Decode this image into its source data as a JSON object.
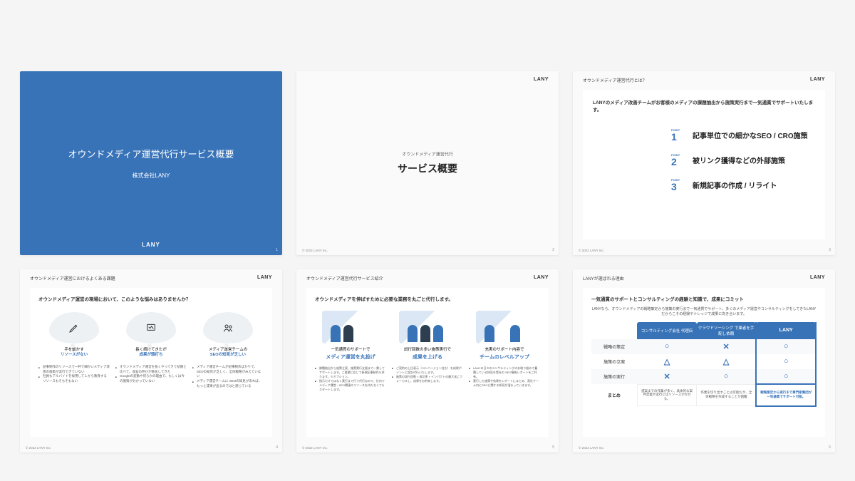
{
  "brand": "LANY",
  "copyright": "© 2022 LANY Inc.",
  "slide1": {
    "title": "オウンドメディア運営代行サービス概要",
    "company": "株式会社LANY",
    "page": "1"
  },
  "slide2": {
    "pre": "オウンドメディア運営代行",
    "title": "サービス概要",
    "page": "2"
  },
  "slide3": {
    "crumb": "オウンドメディア運営代行とは？",
    "intro": "LANYのメディア改善チームがお客様のメディアの課題抽出から施策実行まで一気通貫でサポートいたします。",
    "point_label": "POINT",
    "points": [
      {
        "n": "1",
        "t": "記事単位での細かなSEO / CRO施策"
      },
      {
        "n": "2",
        "t": "被リンク獲得などの外部施策"
      },
      {
        "n": "3",
        "t": "新規記事の作成 / リライト"
      }
    ],
    "page": "3"
  },
  "slide4": {
    "crumb": "オウンドメディア運営におけるよくある課題",
    "q": "オウンドメディア運営の現場において、このような悩みはありませんか？",
    "cols": [
      {
        "pre": "手を動かす",
        "hl": "リソースがない",
        "bullets": [
          "記事制作のリソースで一杯で細かいメディア改善の施策が実行できていない",
          "社員もアルバイトを採用して１から教育するリソースもそもそもない"
        ]
      },
      {
        "pre": "長く続けてきたが",
        "hl": "成果が頭打ち",
        "bullets": [
          "オウンドメディア運営を長くやってきて初期と比べて、収益の伸びが鈍化してきた",
          "Googleの変動や何らかの理由で、もしくは今の施策が分かっていない"
        ]
      },
      {
        "pre": "メディア運営チームの",
        "hl": "SEOの知見が乏しい",
        "bullets": [
          "メディア運営チームが記事制作ばかりで、SEOの知見が乏しく、全体戦略がみえていない",
          "メディア運営チームに SEOの知見があれば、もっと成果が出るのではと感じている"
        ]
      }
    ],
    "page": "4"
  },
  "slide5": {
    "crumb": "オウンドメディア運営代行サービス紹介",
    "q": "オウンドメディアを伸ばすために必要な業務を丸ごと代行します。",
    "cols": [
      {
        "pre": "一気通貫のサポートで",
        "hl": "メディア運営を丸投げ",
        "bullets": [
          "課題抽出から施策立案、施策実行支援まで一貫してサポートします。ご要望に応じて新規記事制作も承ります。※オプション。",
          "指示だけではなく実行まで行う代行なので、社内でメディア運営・SEO関連のリソースを持たなくてもスタートします。"
        ]
      },
      {
        "pre": "試行回数の多い施策実行で",
        "hl": "成果を上げる",
        "bullets": [
          "ご契約の上位表示（コンバージョン含む）を成果ポイントに設計代行いたします。",
          "施策の試行回数 × 成功率 × インパクトの最大化にフォーカスし、成果をお約束します。"
        ]
      },
      {
        "pre": "充実のサポート内容で",
        "hl": "チームのレベルアップ",
        "bullets": [
          "LANYの日々のコンサルティングのお取り組みで蓄積している知見を貴社の SEO情報レポートをご共有。",
          "実行した施策や効果をレポートにまとめ、貴社チーム内にSEOに関する知見が溜まっていきます。"
        ]
      }
    ],
    "page": "5"
  },
  "slide6": {
    "crumb": "LANYが選ばれる理由",
    "q": "一気通貫のサポートとコンサルティングの経験と知識で、成果にコミット",
    "desc": "LANYなら、オウンドメディアの戦略策定から施策の実行まで一気通貫でサポート。多くのメディア運営やコンサルティングをしてきたLANYだからこその経験やナレッジで成果に向き合います。",
    "headers": [
      "",
      "コンサルティング会社\n代理店",
      "クラウドソーシング\nで業者を手配し依頼",
      "LANY"
    ],
    "rows": [
      {
        "label": "戦略の策定",
        "cells": [
          "○",
          "✕",
          "○"
        ]
      },
      {
        "label": "施策の立案",
        "cells": [
          "△",
          "△",
          "○"
        ]
      },
      {
        "label": "施策の実行",
        "cells": [
          "✕",
          "○",
          "○"
        ]
      }
    ],
    "summary_label": "まとめ",
    "summary": [
      "提案までの作業が多く、具体的な案件定義や実行にはリソースがかかる。",
      "作業を切り出すことは可能だが、全体戦略を作成することが困難",
      "戦略策定から実行まで専門家集団が一気通貫でサポート可能。"
    ],
    "page": "6"
  }
}
